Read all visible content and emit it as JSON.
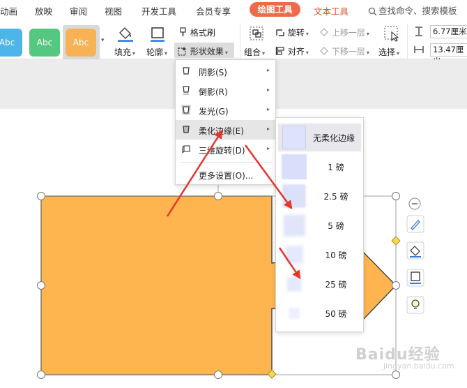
{
  "menu_bar": {
    "items": [
      "动画",
      "放映",
      "审阅",
      "视图",
      "开发工具",
      "会员专享"
    ],
    "active_tab": "绘图工具",
    "text_tab": "文本工具",
    "search_label": "查找命令、搜索模板"
  },
  "ribbon": {
    "style_swatches": [
      "Abc",
      "Abc",
      "Abc"
    ],
    "swatch_colors": [
      "#4db5e8",
      "#54c780",
      "#f8b256"
    ],
    "fill_label": "填充",
    "outline_label": "轮廓",
    "format_painter_label": "格式刷",
    "shape_effects_label": "形状效果",
    "group_label": "组合",
    "rotate_label": "旋转",
    "align_label": "对齐",
    "bring_forward_label": "上移一层",
    "send_backward_label": "下移一层",
    "select_label": "选择",
    "height_value": "6.77厘米",
    "width_value": "13.47厘米"
  },
  "effects_menu": {
    "items": [
      {
        "label": "阴影(S)",
        "has_submenu": true
      },
      {
        "label": "倒影(R)",
        "has_submenu": true
      },
      {
        "label": "发光(G)",
        "has_submenu": true
      },
      {
        "label": "柔化边缘(E)",
        "has_submenu": true
      },
      {
        "label": "三维旋转(D)",
        "has_submenu": true
      }
    ],
    "more_settings": "更多设置(O)...",
    "active_item": "柔化边缘(E)"
  },
  "soft_edges_submenu": {
    "items": [
      "无柔化边缘",
      "1 磅",
      "2.5 磅",
      "5 磅",
      "10 磅",
      "25 磅",
      "50 磅"
    ]
  },
  "shape": {
    "fill_color": "#ffb54f",
    "stroke_color": "#3a3a3a"
  },
  "annotation_color": "#e8342b",
  "watermark": {
    "text": "Baidu经验",
    "sub": "jingyan.baidu.com"
  }
}
